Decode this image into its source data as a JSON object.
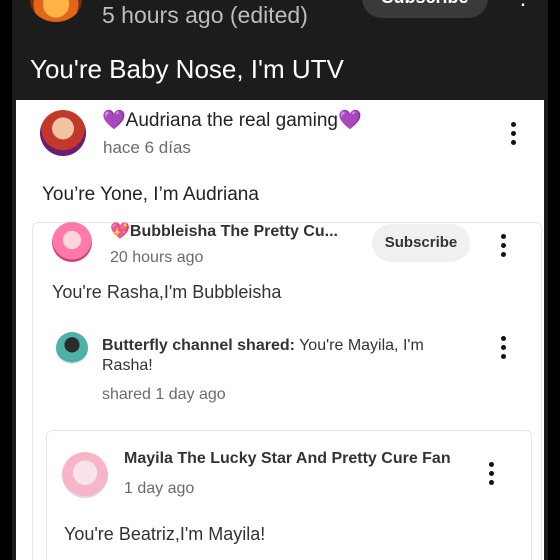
{
  "header": {
    "time": "5 hours ago (edited)",
    "subscribe_label": "Subscribe",
    "post_text": "You're Baby Nose, I'm UTV"
  },
  "comment_main": {
    "heart_left": "💜",
    "author": "Audriana the real gaming",
    "heart_right": "💜",
    "time": "hace 6 días",
    "text": "You’re Yone, I’m Audriana"
  },
  "comment_bubbleisha": {
    "heart": "💖",
    "author": "Bubbleisha The Pretty Cu...",
    "subscribe_label": "Subscribe",
    "time": "20 hours ago",
    "text": "You're Rasha,I'm Bubbleisha"
  },
  "comment_butterfly": {
    "author": "Butterfly channel",
    "shared_label": "shared:",
    "shared_text": "You're Mayila, I'm Rasha!",
    "time": "shared 1 day ago"
  },
  "comment_mayila": {
    "author": "Mayila The Lucky Star And Pretty Cure Fan",
    "time": "1 day ago",
    "text": "You're Beatriz,I'm Mayila!"
  },
  "colors": {
    "background": "#1c1c1c",
    "card": "#ffffff",
    "heart_purple": "#9b3fd6",
    "heart_pink": "#e04a8a"
  }
}
